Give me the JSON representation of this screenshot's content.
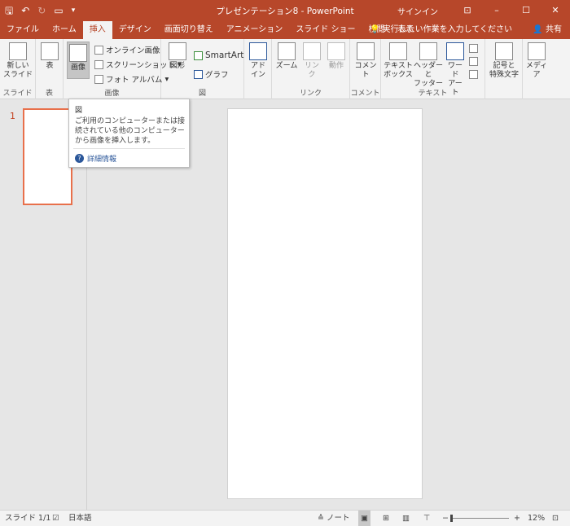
{
  "titlebar": {
    "title": "プレゼンテーション8  -  PowerPoint",
    "signin": "サインイン",
    "qat": [
      "save-icon",
      "undo-icon",
      "redo-icon",
      "start-from-beginning-icon",
      "customize-qat-icon"
    ]
  },
  "tabs": [
    {
      "label": "ファイル"
    },
    {
      "label": "ホーム"
    },
    {
      "label": "挿入",
      "active": true
    },
    {
      "label": "デザイン"
    },
    {
      "label": "画面切り替え"
    },
    {
      "label": "アニメーション"
    },
    {
      "label": "スライド ショー"
    },
    {
      "label": "校閲"
    },
    {
      "label": "表示"
    }
  ],
  "tellme": "実行したい作業を入力してください",
  "share": "共有",
  "ribbon": {
    "slides": {
      "new_slide": "新しい\nスライド",
      "label": "スライド"
    },
    "tables": {
      "table": "表",
      "label": "表"
    },
    "images": {
      "picture": "画像",
      "online": "オンライン画像",
      "screenshot": "スクリーンショット",
      "album": "フォト アルバム",
      "label": "画像"
    },
    "illustrations": {
      "shapes": "図形",
      "smartart": "SmartArt",
      "chart": "グラフ",
      "label": "図"
    },
    "addins": {
      "addin": "アドイン"
    },
    "links": {
      "zoom": "ズーム",
      "link": "リンク",
      "action": "動作",
      "label": "リンク"
    },
    "comments": {
      "comment": "コメント",
      "label": "コメント"
    },
    "text": {
      "textbox": "テキスト\nボックス",
      "header": "ヘッダーと\nフッター",
      "wordart": "ワード\nアート",
      "label": "テキスト"
    },
    "symbols": {
      "symbol": "記号と\n特殊文字"
    },
    "media": {
      "media": "メディア"
    }
  },
  "tooltip": {
    "title": "図",
    "body": "ご利用のコンピューターまたは接続されている他のコンピューターから画像を挿入します。",
    "help": "詳細情報"
  },
  "thumbnail": {
    "number": "1"
  },
  "statusbar": {
    "slide": "スライド 1/1",
    "language": "日本語",
    "notes": "ノート",
    "zoom": "12%"
  }
}
